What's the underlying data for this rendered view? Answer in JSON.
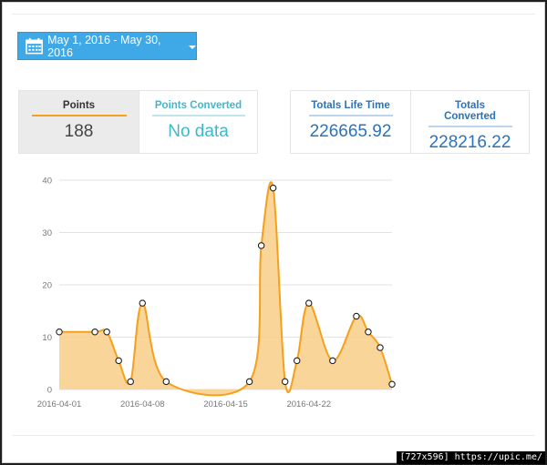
{
  "date_range": {
    "label": "May 1, 2016 - May 30, 2016"
  },
  "stats": {
    "points": {
      "label": "Points",
      "value": "188"
    },
    "points_converted": {
      "label": "Points Converted",
      "value": "No data"
    },
    "totals_life_time": {
      "label": "Totals Life Time",
      "value": "226665.92"
    },
    "totals_converted": {
      "label": "Totals Converted",
      "value": "228216.22"
    }
  },
  "colors": {
    "accent": "#3fa9e8",
    "series_line": "#f5a01b",
    "series_fill": "#f8d08e"
  },
  "chart_data": {
    "type": "area",
    "x_ticks": [
      "2016-04-01",
      "2016-04-08",
      "2016-04-15",
      "2016-04-22"
    ],
    "x": [
      "2016-04-01",
      "2016-04-04",
      "2016-04-05",
      "2016-04-06",
      "2016-04-07",
      "2016-04-08",
      "2016-04-10",
      "2016-04-17",
      "2016-04-18",
      "2016-04-19",
      "2016-04-20",
      "2016-04-21",
      "2016-04-22",
      "2016-04-24",
      "2016-04-26",
      "2016-04-27",
      "2016-04-28",
      "2016-04-29"
    ],
    "values": [
      11,
      11,
      11,
      5.5,
      1.5,
      16.5,
      1.5,
      1.5,
      27.5,
      38.5,
      1.5,
      5.5,
      16.5,
      5.5,
      14,
      11,
      8,
      1
    ],
    "y_ticks": [
      0,
      10,
      20,
      30,
      40
    ],
    "ylim": [
      0,
      40
    ],
    "xlim": [
      "2016-04-01",
      "2016-04-29"
    ],
    "grid": true
  },
  "watermark": "[727x596] https://upic.me/"
}
